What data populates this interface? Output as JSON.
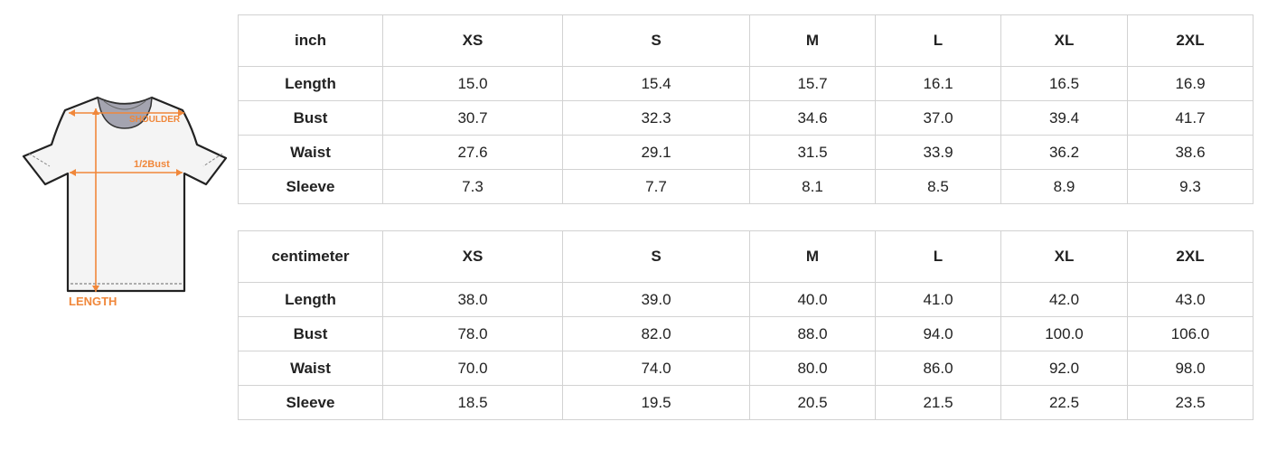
{
  "illustration": {
    "label_shoulder": "SHOULDER",
    "label_bust": "1/2Bust",
    "label_length": "LENGTH",
    "accent_color": "#f0873a"
  },
  "tables": [
    {
      "unit": "inch",
      "sizes": [
        "XS",
        "S",
        "M",
        "L",
        "XL",
        "2XL"
      ],
      "rows": [
        {
          "label": "Length",
          "values": [
            "15.0",
            "15.4",
            "15.7",
            "16.1",
            "16.5",
            "16.9"
          ]
        },
        {
          "label": "Bust",
          "values": [
            "30.7",
            "32.3",
            "34.6",
            "37.0",
            "39.4",
            "41.7"
          ]
        },
        {
          "label": "Waist",
          "values": [
            "27.6",
            "29.1",
            "31.5",
            "33.9",
            "36.2",
            "38.6"
          ]
        },
        {
          "label": "Sleeve",
          "values": [
            "7.3",
            "7.7",
            "8.1",
            "8.5",
            "8.9",
            "9.3"
          ]
        }
      ]
    },
    {
      "unit": "centimeter",
      "sizes": [
        "XS",
        "S",
        "M",
        "L",
        "XL",
        "2XL"
      ],
      "rows": [
        {
          "label": "Length",
          "values": [
            "38.0",
            "39.0",
            "40.0",
            "41.0",
            "42.0",
            "43.0"
          ]
        },
        {
          "label": "Bust",
          "values": [
            "78.0",
            "82.0",
            "88.0",
            "94.0",
            "100.0",
            "106.0"
          ]
        },
        {
          "label": "Waist",
          "values": [
            "70.0",
            "74.0",
            "80.0",
            "86.0",
            "92.0",
            "98.0"
          ]
        },
        {
          "label": "Sleeve",
          "values": [
            "18.5",
            "19.5",
            "20.5",
            "21.5",
            "22.5",
            "23.5"
          ]
        }
      ]
    }
  ]
}
